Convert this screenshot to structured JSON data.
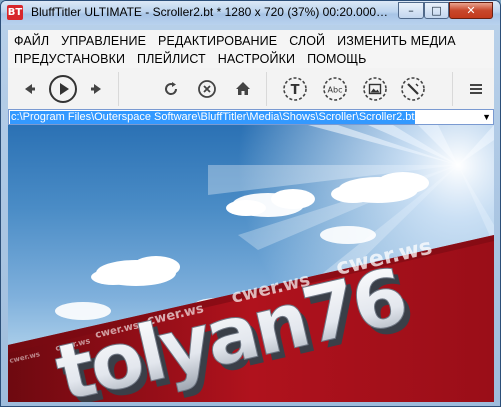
{
  "window": {
    "title": "BluffTitler ULTIMATE  - Scroller2.bt * 1280 x 720 (37%) 00:20.000 P...",
    "app_icon_text": "BT",
    "min_glyph": "–",
    "max_glyph": "□",
    "close_glyph": "✕"
  },
  "menu": {
    "row1": [
      "ФАЙЛ",
      "УПРАВЛЕНИЕ",
      "РЕДАКТИРОВАНИЕ",
      "СЛОЙ",
      "ИЗМЕНИТЬ МЕДИА"
    ],
    "row2": [
      "ПРЕДУСТАНОВКИ",
      "ПЛЕЙЛИСТ",
      "НАСТРОЙКИ",
      "ПОМОЩЬ"
    ]
  },
  "toolbar": {
    "icons": [
      "prev-icon",
      "play-icon",
      "next-icon",
      "refresh-icon",
      "stop-icon",
      "home-icon",
      "add-text-layer-icon",
      "add-abc-layer-icon",
      "add-picture-layer-icon",
      "add-effect-layer-icon",
      "menu-icon"
    ],
    "text_layer_label": "T",
    "abc_layer_label": "Abc"
  },
  "address": {
    "value": "c:\\Program Files\\Outerspace Software\\BluffTitler\\Media\\Shows\\Scroller\\Scroller2.bt"
  },
  "preview": {
    "main_text": "tolyan76",
    "watermarks": [
      "cwer.ws",
      "cwer.ws",
      "cwer.ws",
      "cwer.ws",
      "cwer.ws",
      "cwer.ws"
    ],
    "colors": {
      "banner": "#b0121d",
      "sky_top": "#2b71b4",
      "sky_bottom": "#c4dcee",
      "text_face": "#f2f4f8"
    }
  }
}
